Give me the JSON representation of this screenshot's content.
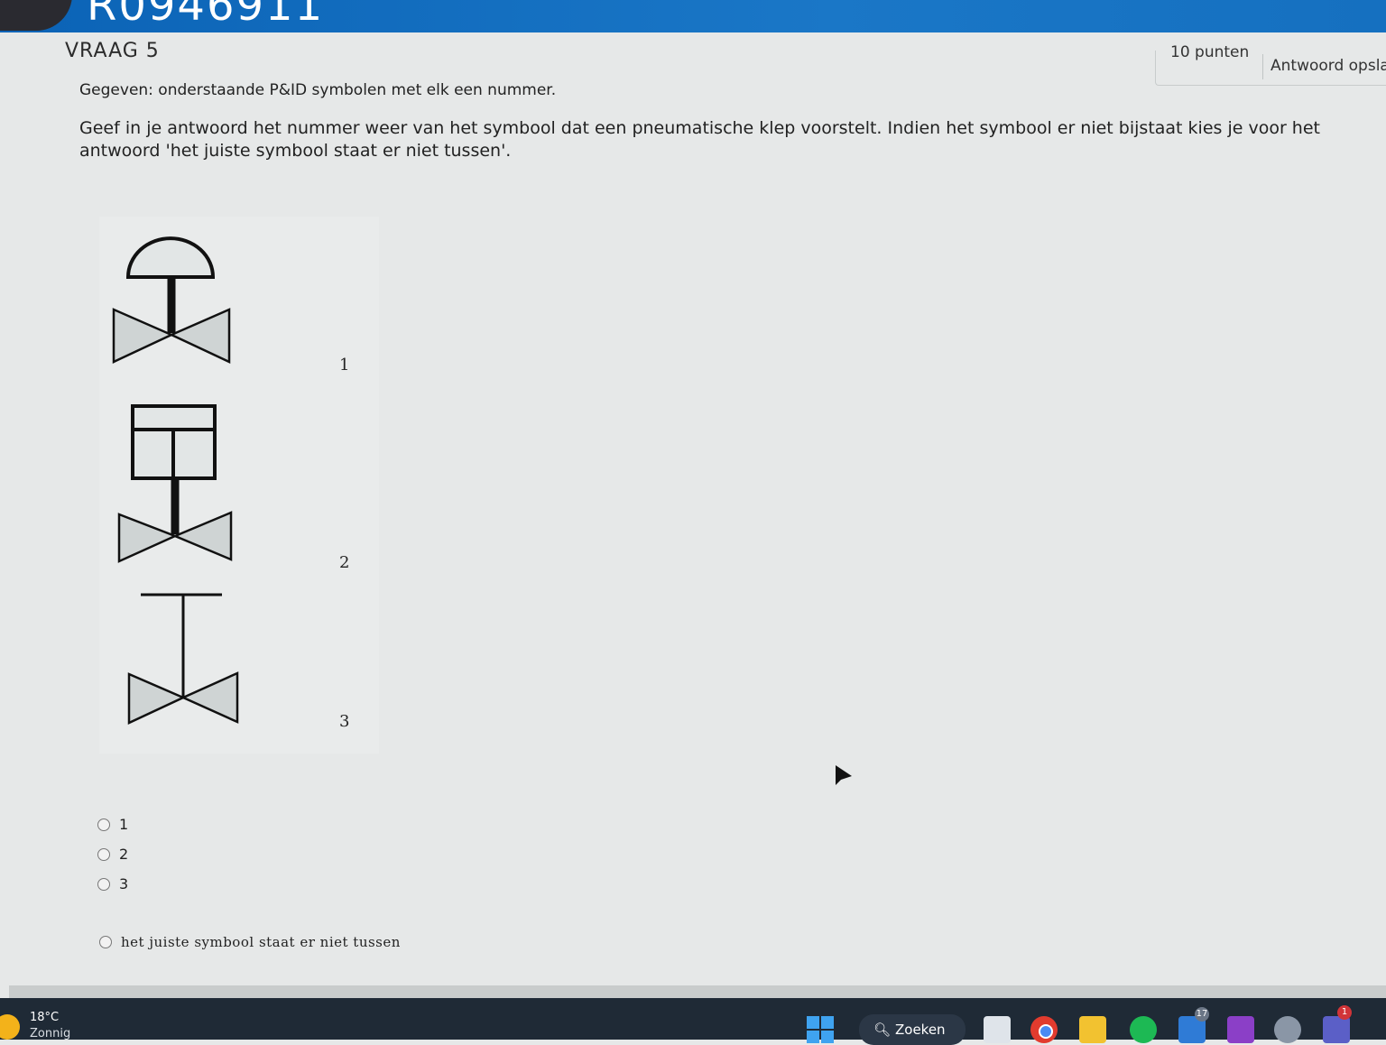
{
  "header": {
    "student_id": "R0946911"
  },
  "question": {
    "title": "VRAAG 5",
    "points": "10 punten",
    "answer_sheet_button": "Antwoord opsla",
    "given": "Gegeven: onderstaande P&ID symbolen met elk een nummer.",
    "instruction": "Geef in je antwoord het nummer weer van het symbool dat een pneumatische klep voorstelt. Indien het symbool er niet bijstaat kies je voor het antwoord 'het juiste symbool staat er niet tussen'."
  },
  "symbols": {
    "labels": [
      "1",
      "2",
      "3"
    ]
  },
  "options": [
    {
      "label": "1",
      "selected": false
    },
    {
      "label": "2",
      "selected": false
    },
    {
      "label": "3",
      "selected": false
    },
    {
      "label": "het juiste symbool staat er niet tussen",
      "selected": false
    }
  ],
  "taskbar": {
    "temperature": "18°C",
    "weather": "Zonnig",
    "search_label": "Zoeken",
    "teams_badge": "17",
    "notification_badge": "1"
  },
  "colors": {
    "header_blue": "#0b63b6",
    "taskbar": "#1f2a36",
    "page_background": "#e6e8e8"
  }
}
